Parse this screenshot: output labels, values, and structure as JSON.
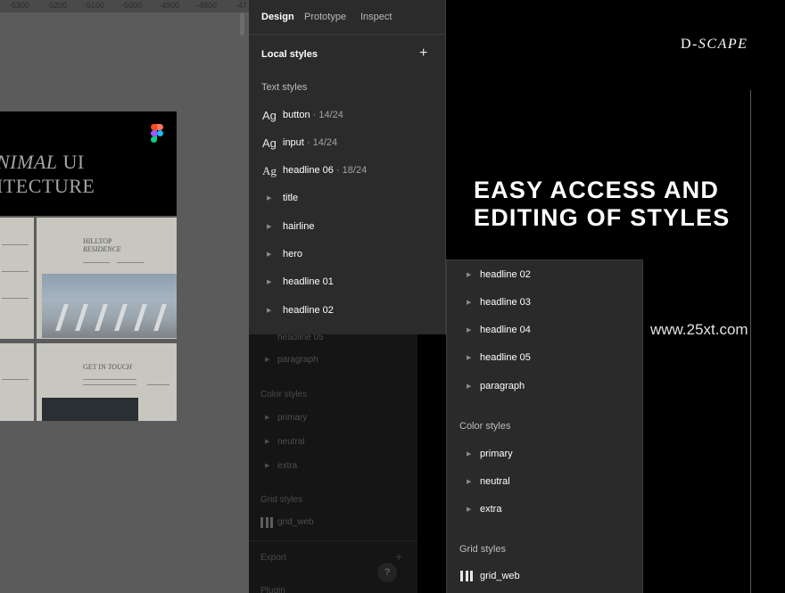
{
  "canvas": {
    "ruler_ticks": [
      "-5300",
      "-5200",
      "-5100",
      "-5000",
      "-4900",
      "-4800",
      "-47"
    ],
    "hero_line1_prefix": "NIMAL",
    "hero_line1_suffix": " UI",
    "hero_line2": "ITECTURE",
    "thumb_hilltop": "HILLTOP",
    "thumb_residence": "RESIDENCE",
    "thumb_get_in": "GET IN ",
    "thumb_touch": "TOUCH"
  },
  "panel": {
    "tabs": [
      "Design",
      "Prototype",
      "Inspect"
    ],
    "local_styles": "Local styles",
    "add_icon": "plus-icon",
    "text_styles_label": "Text styles",
    "text_styles": [
      {
        "name": "button",
        "meta": " · 14/24",
        "kind": "ag"
      },
      {
        "name": "input",
        "meta": " · 14/24",
        "kind": "ag"
      },
      {
        "name": "headline 06",
        "meta": " · 18/24",
        "kind": "ag-serif"
      },
      {
        "name": "title",
        "kind": "group"
      },
      {
        "name": "hairline",
        "kind": "group"
      },
      {
        "name": "hero",
        "kind": "group"
      },
      {
        "name": "headline 01",
        "kind": "group"
      },
      {
        "name": "headline 02",
        "kind": "group"
      }
    ],
    "ag_glyph": "Ag"
  },
  "panel_bg": {
    "items": [
      "headline 05",
      "paragraph"
    ],
    "color_styles_label": "Color styles",
    "colors": [
      "primary",
      "neutral",
      "extra"
    ],
    "grid_styles_label": "Grid styles",
    "grid": "grid_web",
    "export": "Export",
    "plugin": "Plugin",
    "help": "?"
  },
  "panel_front": {
    "text_groups": [
      "headline 02",
      "headline 03",
      "headline 04",
      "headline 05",
      "paragraph"
    ],
    "color_styles_label": "Color styles",
    "colors": [
      "primary",
      "neutral",
      "extra"
    ],
    "grid_styles_label": "Grid styles",
    "grid": "grid_web"
  },
  "marketing": {
    "brand_prefix": "D-",
    "brand_suffix": "SCAPE",
    "headline_line1": "EASY ACCESS AND",
    "headline_line2": "EDITING OF STYLES",
    "watermark": "www.25xt.com"
  },
  "colors": {
    "background": "#000000",
    "panel": "#2b2b2b",
    "canvas": "#5b5b5b"
  }
}
